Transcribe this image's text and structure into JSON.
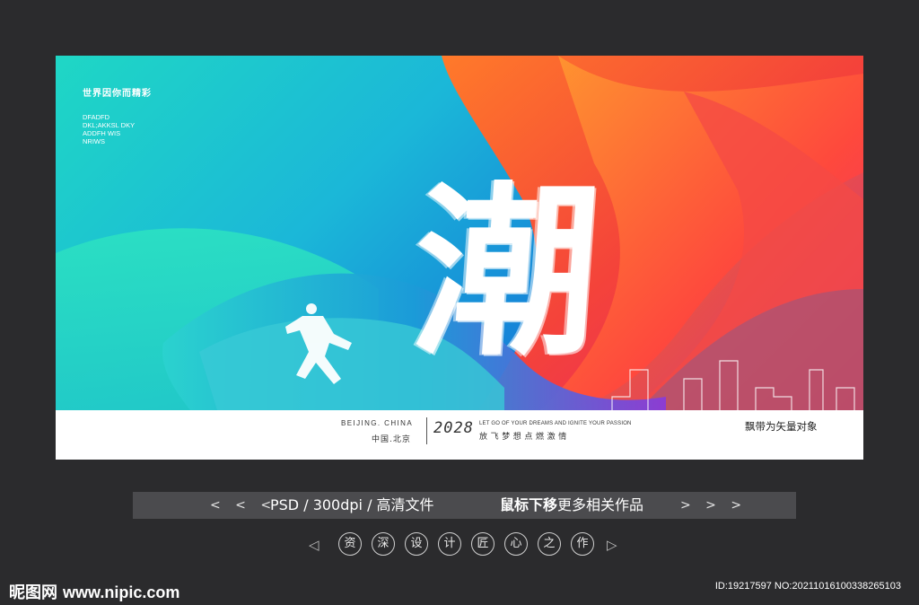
{
  "poster": {
    "tagline": "世界因你而精彩",
    "small_lines": [
      "DFADFD",
      "DKL;AKKSL DKY",
      "ADDFH WIS",
      "NRIWS"
    ],
    "big_char": "潮",
    "beijing": "BEIJING. CHINA",
    "china_beijing": "中国.北京",
    "year": "2028",
    "slogan_en": "LET GO OF YOUR DREAMS AND IGNITE YOUR PASSION",
    "slogan_cn": "放飞梦想点燃激情",
    "ribbon_note": "飘带为矢量对象",
    "colors": {
      "teal": "#1fd7c5",
      "blue": "#1473d8",
      "ribbon_red": "#f4433a",
      "ribbon_pink": "#f0306a"
    }
  },
  "infobar": {
    "left_arrows": "< < <",
    "spec": "PSD /  300dpi /  高清文件",
    "cta_bold": "鼠标下移",
    "cta_rest": "更多相关作品",
    "right_arrows": "> > >"
  },
  "tagline_row": {
    "left_tri": "◁",
    "chars": [
      "资",
      "深",
      "设",
      "计",
      "匠",
      "心",
      "之",
      "作"
    ],
    "right_tri": "▷"
  },
  "footer": {
    "logo": "昵图网",
    "url": "www.nipic.com",
    "id_line": "ID:19217597 NO:20211016100338265103"
  }
}
